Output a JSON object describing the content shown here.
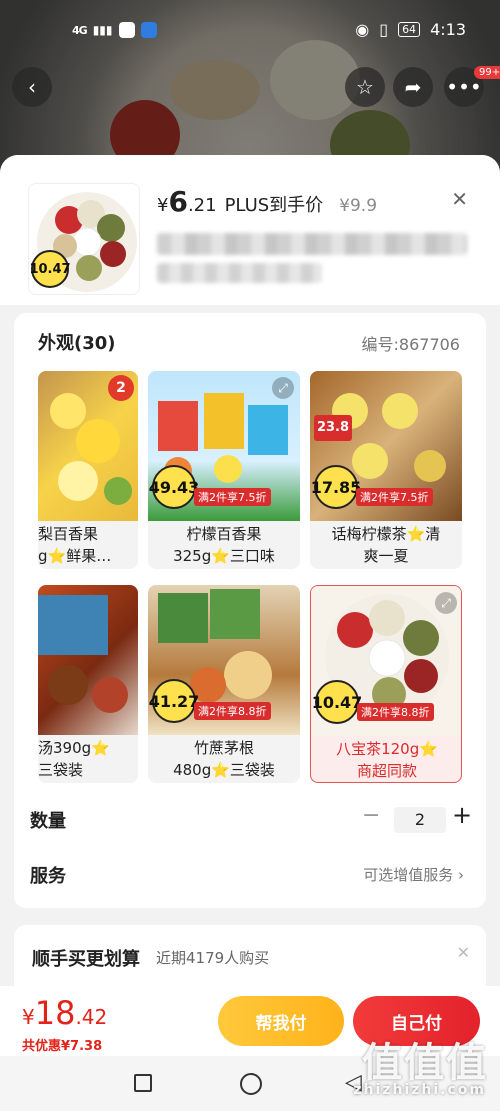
{
  "status_bar": {
    "network": "4G",
    "time": "4:13",
    "battery": "64"
  },
  "nav": {
    "notification_count": "99+"
  },
  "header": {
    "currency": "¥",
    "price_int": "6",
    "price_dec": ".21",
    "price_note": "PLUS到手价",
    "original_price": "¥9.9"
  },
  "appearance": {
    "title": "外观(30)",
    "sku_code": "编号:867706",
    "items": [
      {
        "label": "梨百香果\ng⭐鲜果…",
        "badge": "2",
        "selected": false
      },
      {
        "label": "柠檬百香果\n325g⭐三口味",
        "price_tag": "49.43",
        "promo": "满2件享7.5折",
        "selected": false
      },
      {
        "label": "话梅柠檬茶⭐清\n爽一夏",
        "price_tag": "17.85",
        "promo": "满2件享7.5折",
        "selected": false
      },
      {
        "label": "汤390g⭐\n三袋装",
        "selected": false
      },
      {
        "label": "竹蔗茅根\n480g⭐三袋装",
        "price_tag": "41.27",
        "promo": "满2件享8.8折",
        "selected": false
      },
      {
        "label": "八宝茶120g⭐\n商超同款",
        "price_tag": "10.47",
        "promo": "满2件享8.8折",
        "selected": true
      }
    ]
  },
  "thumb_price_tag": "10.47",
  "quantity": {
    "label": "数量",
    "value": "2",
    "minus": "−",
    "plus": "+"
  },
  "service": {
    "label": "服务",
    "value": "可选增值服务"
  },
  "bundle": {
    "title": "顺手买更划算",
    "subtitle": "近期4179人购买"
  },
  "bottom": {
    "currency": "¥",
    "total_int": "18",
    "total_dec": ".42",
    "saving": "共优惠¥7.38",
    "help_pay": "帮我付",
    "self_pay": "自己付"
  },
  "watermark": {
    "main": "值值值",
    "sub": "zhizhizhi.com"
  }
}
